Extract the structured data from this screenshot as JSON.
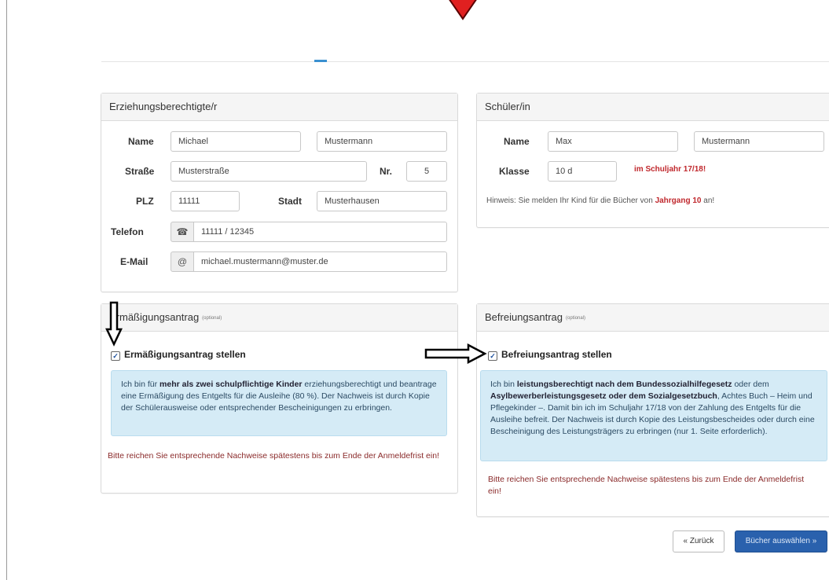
{
  "guardian": {
    "title": "Erziehungsberechtigte/r",
    "labels": {
      "name": "Name",
      "street": "Straße",
      "nr": "Nr.",
      "plz": "PLZ",
      "city": "Stadt",
      "phone": "Telefon",
      "email": "E-Mail"
    },
    "firstname": "Michael",
    "lastname": "Mustermann",
    "street": "Musterstraße",
    "nr": "5",
    "plz": "11111",
    "city": "Musterhausen",
    "phone": "11111 / 12345",
    "email": "michael.mustermann@muster.de"
  },
  "student": {
    "title": "Schüler/in",
    "labels": {
      "name": "Name",
      "class": "Klasse"
    },
    "firstname": "Max",
    "lastname": "Mustermann",
    "class": "10 d",
    "school_year": "im Schuljahr 17/18!",
    "hint_prefix": "Hinweis: Sie melden Ihr Kind für die Bücher von",
    "hint_grade": "Jahrgang 10",
    "hint_suffix": "an!"
  },
  "reduction": {
    "title": "Ermäßigungsantrag",
    "optional": "(optional)",
    "checkbox_label": "Ermäßigungsantrag stellen",
    "info_1": "Ich bin für",
    "info_bold": "mehr als zwei schulpflichtige Kinder",
    "info_2": "erziehungsberechtigt und beantrage eine Ermäßigung des Entgelts für die Ausleihe (80 %). Der Nachweis ist durch Kopie der Schülerausweise oder entsprechender Bescheinigungen zu erbringen.",
    "warning": "Bitte reichen Sie entsprechende Nachweise spätestens bis zum Ende der Anmeldefrist ein!"
  },
  "exemption": {
    "title": "Befreiungsantrag",
    "optional": "(optional)",
    "checkbox_label": "Befreiungsantrag stellen",
    "info_1": "Ich bin",
    "info_bold1": "leistungsberechtigt nach dem Bundessozialhilfegesetz",
    "info_2": "oder dem",
    "info_bold2": "Asylbewerberleistungsgesetz oder dem Sozialgesetzbuch",
    "info_3": ", Achtes Buch – Heim und Pflegekinder –. Damit bin ich im Schuljahr 17/18 von der Zahlung des Entgelts für die Ausleihe befreit. Der Nachweis ist durch Kopie des Leistungsbescheides oder durch eine Bescheinigung des Leistungsträgers zu erbringen (nur 1. Seite erforderlich).",
    "warning": "Bitte reichen Sie entsprechende Nachweise spätestens bis zum Ende der Anmeldefrist ein!"
  },
  "buttons": {
    "back": "« Zurück",
    "next": "Bücher auswählen »"
  },
  "icons": {
    "phone": "☎",
    "email": "@",
    "check": "✓"
  },
  "colors": {
    "primary": "#2a61ad",
    "info_bg": "#d5ebf6",
    "warning_text": "#8a2a2a",
    "highlight_red": "#c0282d",
    "arrow_red": "#e02020"
  }
}
